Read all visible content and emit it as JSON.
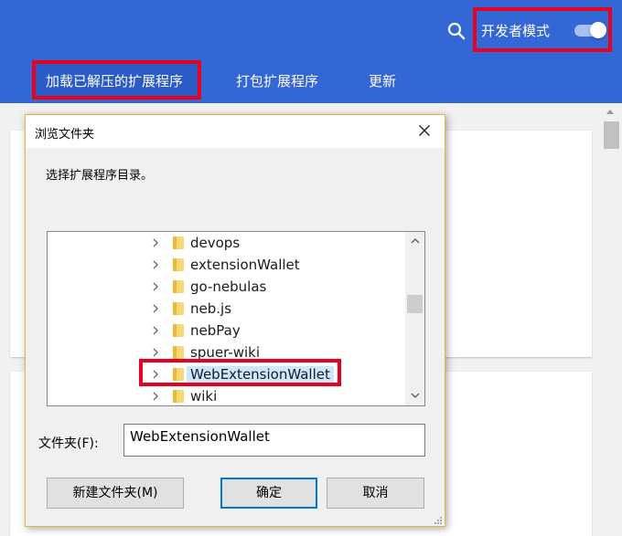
{
  "header": {
    "dev_mode_label": "开发者模式",
    "dev_mode_on": true,
    "actions": {
      "load_unpacked": "加载已解压的扩展程序",
      "pack": "打包扩展程序",
      "update": "更新"
    }
  },
  "dialog": {
    "title": "浏览文件夹",
    "prompt": "选择扩展程序目录。",
    "tree_items": [
      {
        "label": "devops"
      },
      {
        "label": "extensionWallet"
      },
      {
        "label": "go-nebulas"
      },
      {
        "label": "neb.js"
      },
      {
        "label": "nebPay"
      },
      {
        "label": "spuer-wiki"
      },
      {
        "label": "WebExtensionWallet",
        "selected": true
      },
      {
        "label": "wiki"
      }
    ],
    "folder_label": "文件夹(F):",
    "folder_value": "WebExtensionWallet",
    "buttons": {
      "new_folder": "新建文件夹(M)",
      "ok": "确定",
      "cancel": "取消"
    }
  },
  "colors": {
    "header_bg": "#3367d6",
    "highlight_box": "#e8001c",
    "selection_bg": "#cce8ff",
    "folder_yellow": "#f8d775"
  }
}
